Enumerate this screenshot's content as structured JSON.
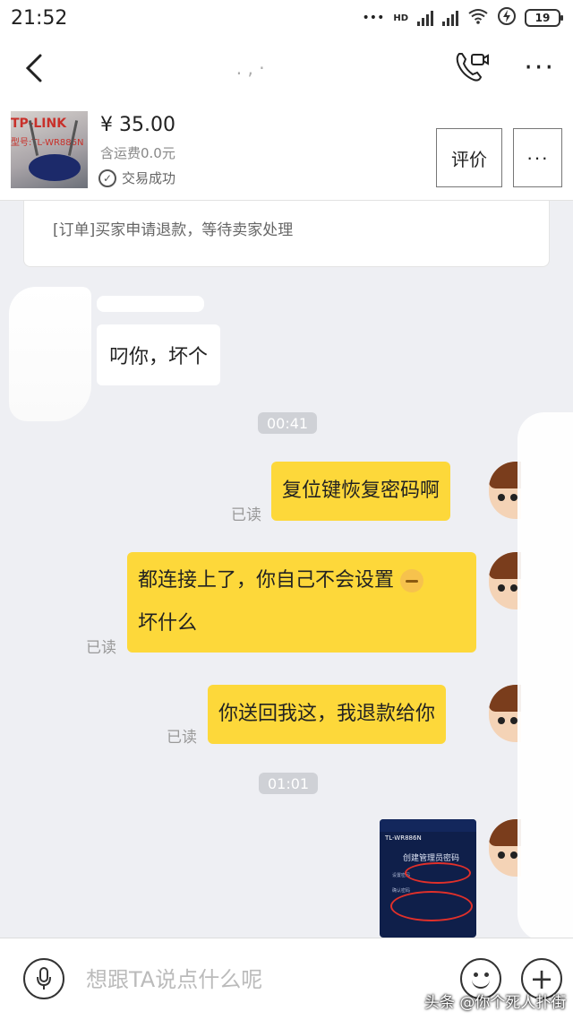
{
  "status_bar": {
    "time": "21:52",
    "network": "HD",
    "battery": "19"
  },
  "nav": {
    "title": ".   ,   ·"
  },
  "product": {
    "price": "¥ 35.00",
    "shipping": "含运费0.0元",
    "trade_status": "交易成功",
    "thumb_brand": "TP-LINK",
    "thumb_model": "型号:TL-WR886N",
    "rate_label": "评价",
    "more_label": "···"
  },
  "order_notice": "[订单]买家申请退款，等待卖家处理",
  "messages": {
    "incoming_1": "叼你，坏个",
    "time_1": "00:41",
    "out_1": "复位键恢复密码啊",
    "out_2_line1": "都连接上了，你自己不会设置",
    "out_2_line2": "坏什么",
    "out_3": "你送回我这，我退款给你",
    "time_2": "01:01",
    "read": "已读"
  },
  "screenshot": {
    "title": "TL-WR886N",
    "heading": "创建管理员密码",
    "row1": "设置密码",
    "row2": "确认密码"
  },
  "input": {
    "placeholder": "想跟TA说点什么呢"
  },
  "watermark": "头条 @你个死人扑街",
  "colors": {
    "bubble_out": "#fdd83a",
    "chat_bg": "#eeeff3"
  }
}
